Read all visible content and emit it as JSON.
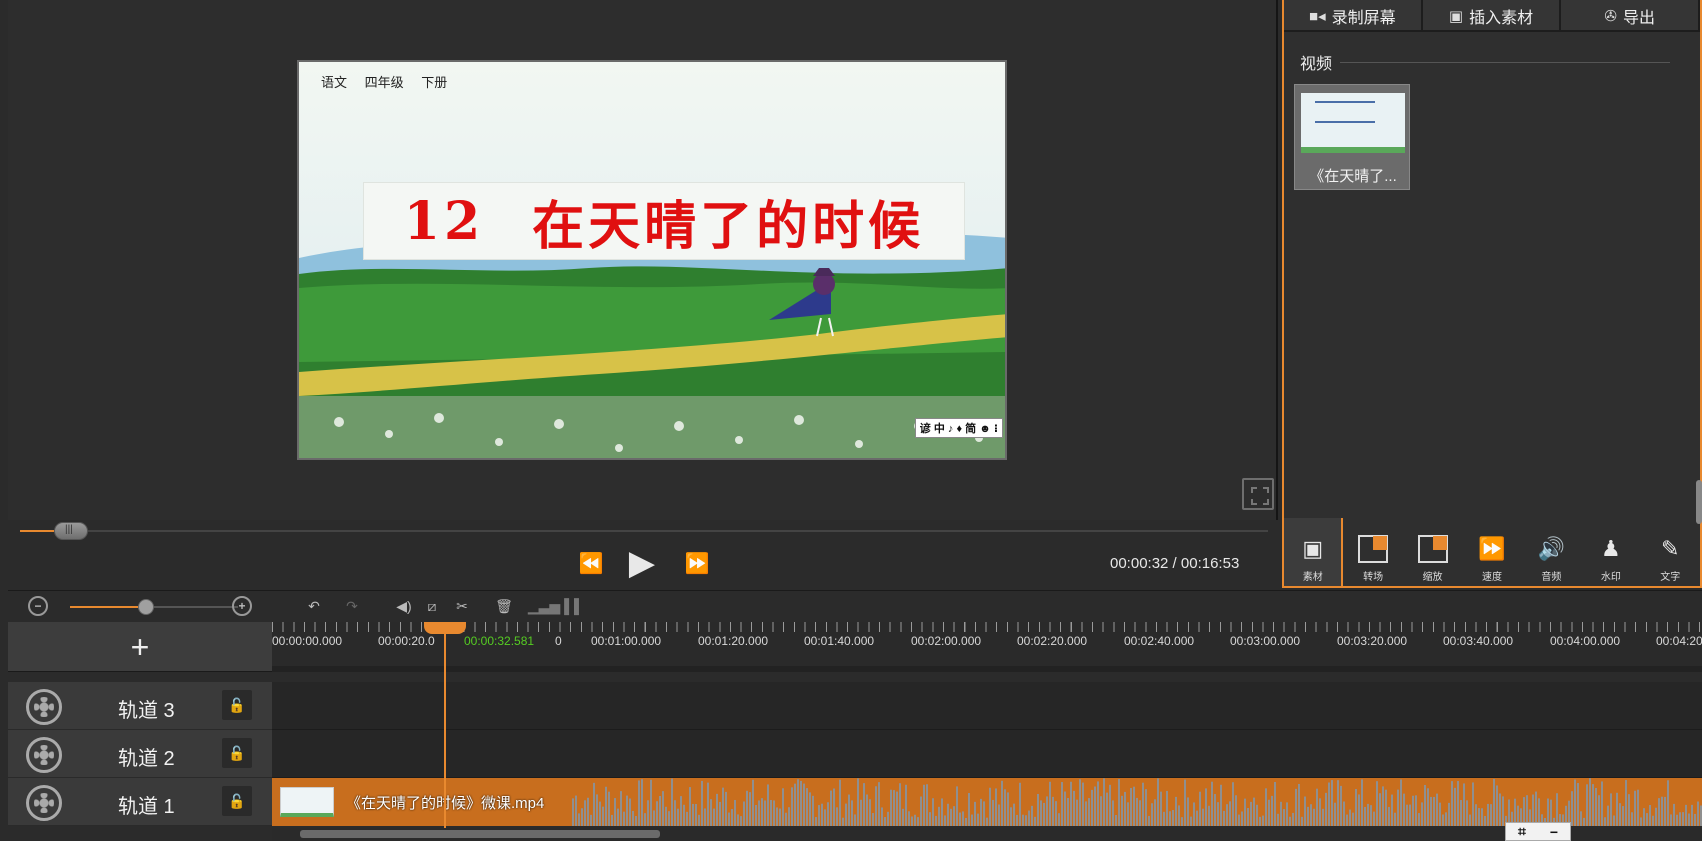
{
  "preview": {
    "video_header": [
      "语文",
      "四年级",
      "下册"
    ],
    "title_number": "12",
    "title_text": "在天晴了的时候",
    "corner_logo": "谚 中 ♪ ♦ 简 ☻ ⁝"
  },
  "transport": {
    "rewind_icon": "⏪",
    "play_icon": "▶",
    "forward_icon": "⏩",
    "time": "00:00:32 / 00:16:53"
  },
  "right_panel": {
    "tabs": [
      {
        "label": "录制屏幕",
        "icon": "camera-icon"
      },
      {
        "label": "插入素材",
        "icon": "image-icon"
      },
      {
        "label": "导出",
        "icon": "film-reel-icon"
      }
    ],
    "section_label": "视频",
    "media_items": [
      {
        "label": "《在天晴了..."
      }
    ],
    "tools": [
      {
        "label": "素材",
        "icon": "material-icon"
      },
      {
        "label": "转场",
        "icon": "transition-icon"
      },
      {
        "label": "缩放",
        "icon": "zoom-scale-icon"
      },
      {
        "label": "速度",
        "icon": "speed-icon"
      },
      {
        "label": "音频",
        "icon": "audio-icon"
      },
      {
        "label": "水印",
        "icon": "watermark-icon"
      },
      {
        "label": "文字",
        "icon": "pencil-icon"
      }
    ]
  },
  "timeline": {
    "zoom_level": 0.45,
    "playhead_time": "00:00:32.581",
    "ruler_labels": [
      "00:00:00.000",
      "00:00:20.0",
      "0",
      "00:01:00.000",
      "00:01:20.000",
      "00:01:40.000",
      "00:02:00.000",
      "00:02:20.000",
      "00:02:40.000",
      "00:03:00.000",
      "00:03:20.000",
      "00:03:40.000",
      "00:04:00.000",
      "00:04:20"
    ],
    "tracks": [
      {
        "name": "轨道 3"
      },
      {
        "name": "轨道 2"
      },
      {
        "name": "轨道 1"
      }
    ],
    "clip_label": "《在天晴了的时候》微课.mp4"
  },
  "colors": {
    "accent": "#e8892f",
    "playhead_time": "#55cc22",
    "title_red": "#e01010"
  }
}
